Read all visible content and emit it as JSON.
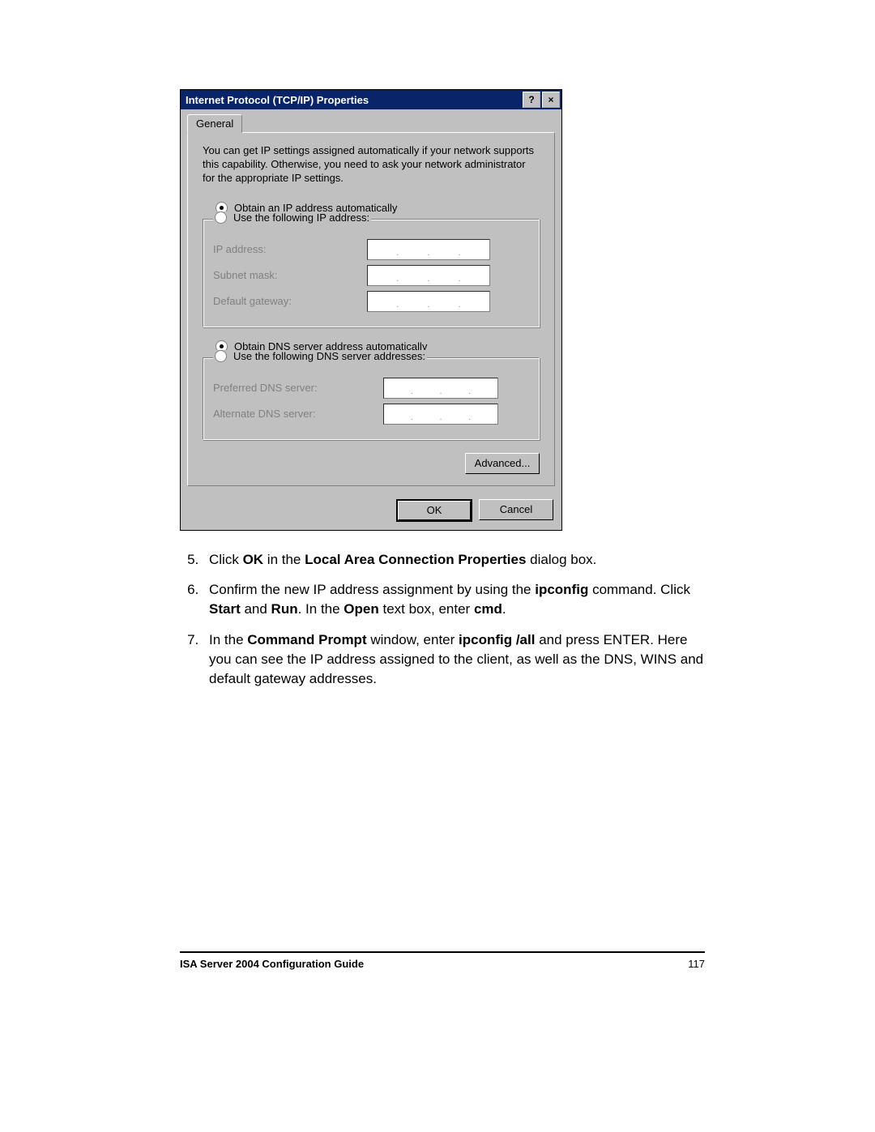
{
  "dialog": {
    "title": "Internet Protocol (TCP/IP) Properties",
    "help_glyph": "?",
    "close_glyph": "×",
    "tab_general": "General",
    "intro": "You can get IP settings assigned automatically if your network supports this capability. Otherwise, you need to ask your network administrator for the appropriate IP settings.",
    "radio_obtain_ip": "Obtain an IP address automatically",
    "radio_use_ip": "Use the following IP address:",
    "label_ip": "IP address:",
    "label_subnet": "Subnet mask:",
    "label_gateway": "Default gateway:",
    "radio_obtain_dns": "Obtain DNS server address automatically",
    "radio_use_dns": "Use the following DNS server addresses:",
    "label_pref_dns": "Preferred DNS server:",
    "label_alt_dns": "Alternate DNS server:",
    "btn_advanced": "Advanced...",
    "btn_ok": "OK",
    "btn_cancel": "Cancel",
    "dot": "."
  },
  "steps": {
    "s5_a": "Click ",
    "s5_ok": "OK",
    "s5_b": " in the ",
    "s5_lacp": "Local Area Connection Properties",
    "s5_c": " dialog box.",
    "s6_a": "Confirm the new IP address assignment by using the ",
    "s6_ipconfig": "ipconfig",
    "s6_b": " command. Click ",
    "s6_start": "Start",
    "s6_c": " and ",
    "s6_run": "Run",
    "s6_d": ". In the ",
    "s6_open": "Open",
    "s6_e": " text box, enter ",
    "s6_cmd": "cmd",
    "s6_f": ".",
    "s7_a": "In the ",
    "s7_cp": "Command Prompt",
    "s7_b": " window, enter ",
    "s7_ipcfgall": "ipconfig /all",
    "s7_c": " and press ENTER. Here you can see the IP address assigned to the client, as well as the DNS, WINS and default gateway addresses."
  },
  "footer": {
    "title": "ISA Server 2004 Configuration Guide",
    "page": "117"
  }
}
